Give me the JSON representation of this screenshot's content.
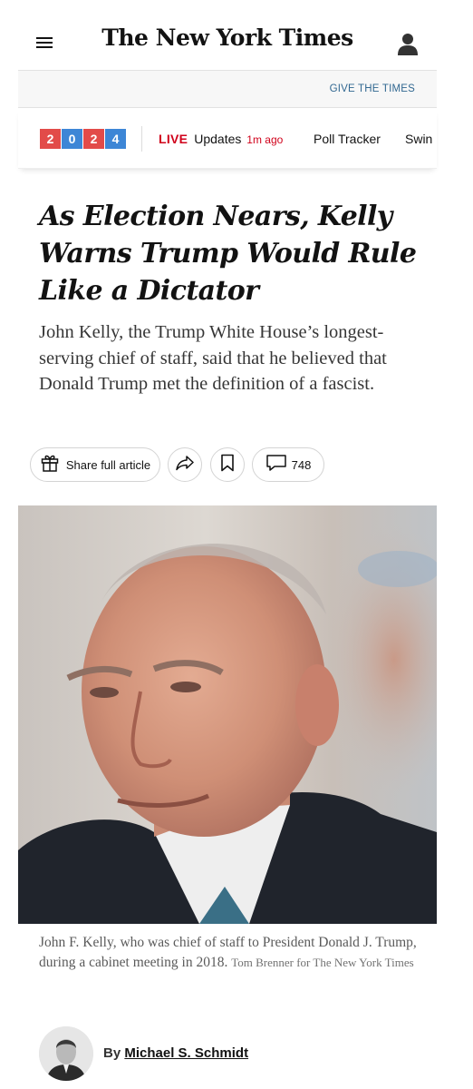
{
  "header": {
    "logo": "The New York Times",
    "give_link": "GIVE THE TIMES"
  },
  "election_bar": {
    "year_digits": [
      "2",
      "0",
      "2",
      "4"
    ],
    "live_label": "LIVE",
    "updates_label": "Updates",
    "updated_ago": "1m ago",
    "poll_tracker": "Poll Tracker",
    "swing": "Swin"
  },
  "article": {
    "headline": "As Election Nears, Kelly Warns Trump Would Rule Like a Dictator",
    "summary": "John Kelly, the Trump White House’s longest-serving chief of staff, said that he believed that Donald Trump met the definition of a fascist.",
    "share_label": "Share full article",
    "comment_count": "748",
    "caption": "John F. Kelly, who was chief of staff to President Donald J. Trump, during a cabinet meeting in 2018.",
    "credit": "Tom Brenner for The New York Times",
    "byline_prefix": "By",
    "author": "Michael S. Schmidt"
  },
  "icons": {
    "menu": "hamburger-menu-icon",
    "account": "person-icon",
    "share": "gift-icon",
    "forward": "share-arrow-icon",
    "save": "bookmark-icon",
    "comments": "speech-bubble-icon"
  },
  "colors": {
    "year_red": "#e24b49",
    "year_blue": "#3d86d6",
    "live_red": "#d0021b",
    "link_blue": "#326891"
  }
}
